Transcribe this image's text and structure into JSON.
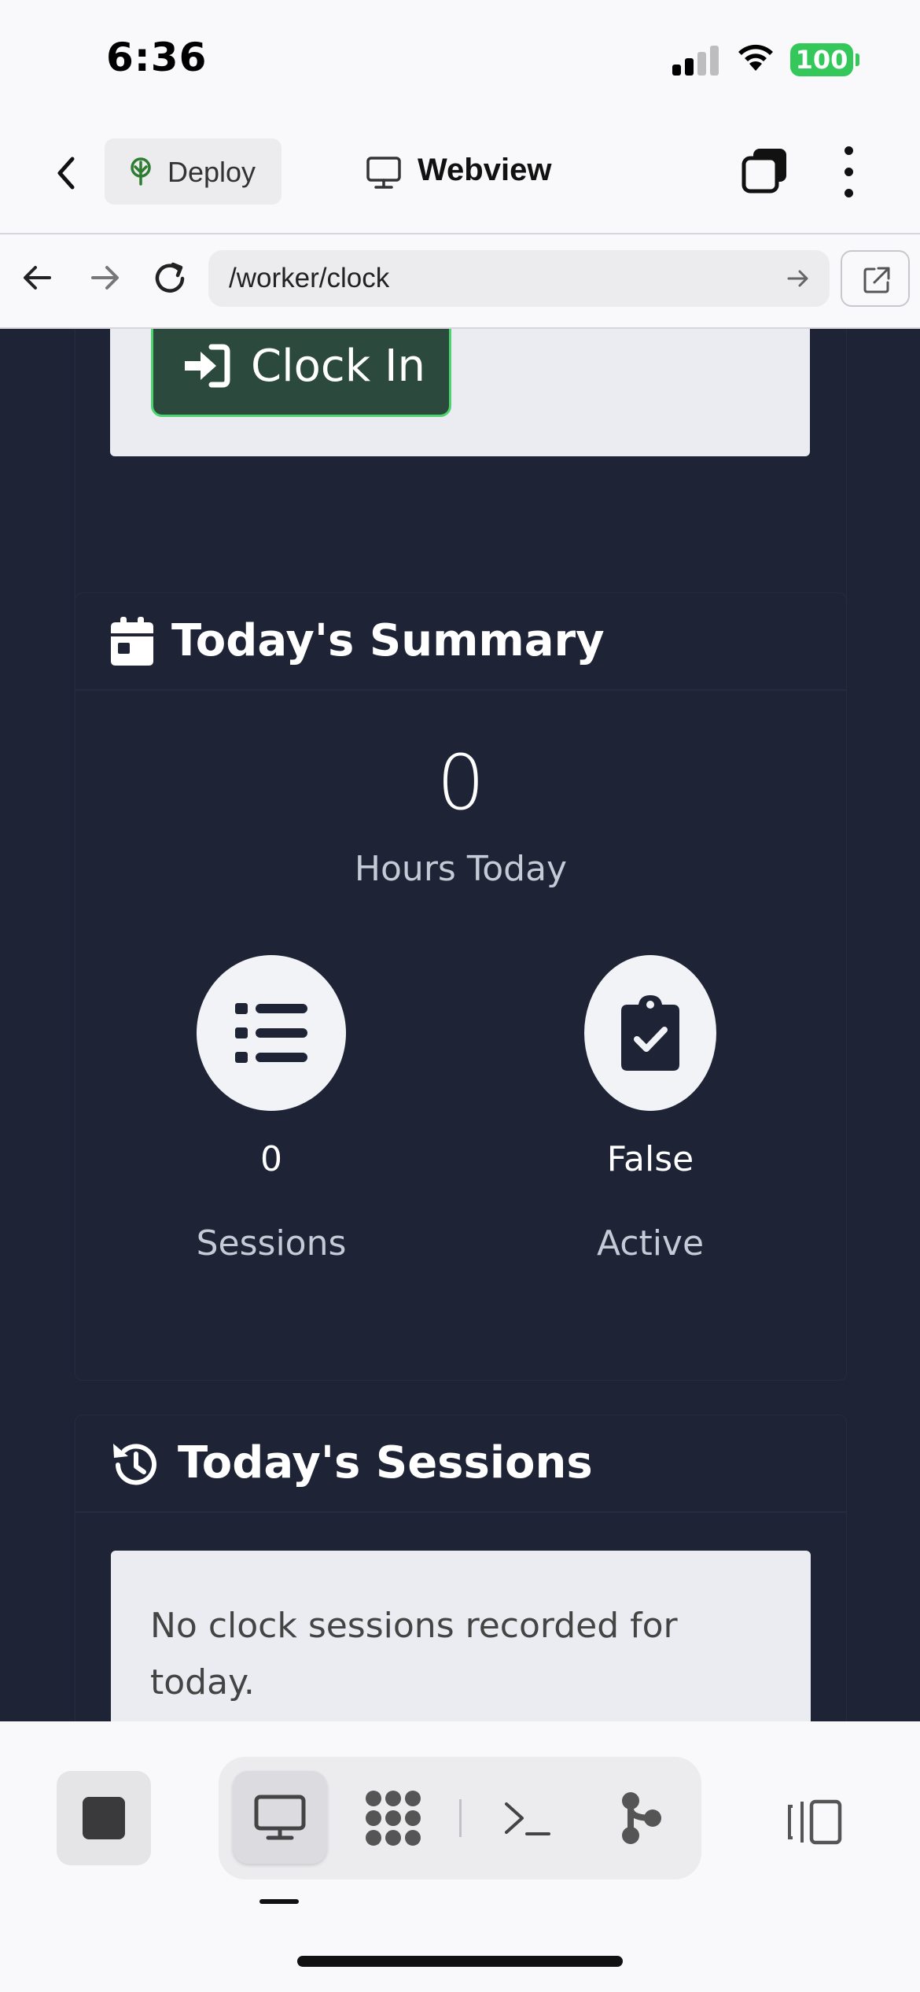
{
  "status_bar": {
    "time": "6:36",
    "battery": "100"
  },
  "app_header": {
    "deploy_label": "Deploy",
    "webview_label": "Webview"
  },
  "browser": {
    "url": "/worker/clock"
  },
  "clock": {
    "button_label": "Clock In"
  },
  "summary": {
    "title": "Today's Summary",
    "hours_value": "0",
    "hours_label": "Hours Today",
    "sessions_value": "0",
    "sessions_label": "Sessions",
    "active_value": "False",
    "active_label": "Active"
  },
  "sessions": {
    "title": "Today's Sessions",
    "empty_message": "No clock sessions recorded for today."
  },
  "colors": {
    "page_background": "#1e2335",
    "clock_in_button": "#2b4a3d",
    "clock_in_border": "#4ed46f",
    "battery": "#34c759"
  },
  "icons": {
    "summary": "calendar-icon",
    "sessions": "history-icon",
    "clock_in": "sign-in-icon",
    "sessions_stat": "list-icon",
    "active_stat": "clipboard-check-icon"
  }
}
